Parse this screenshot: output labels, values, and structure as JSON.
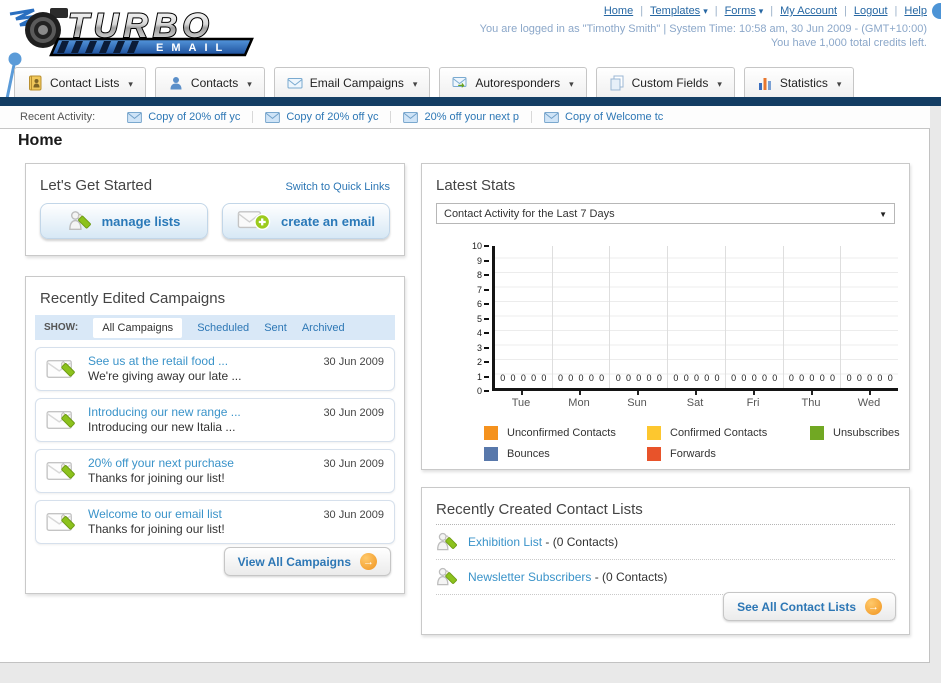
{
  "logo": {
    "brand": "TURBO",
    "sub": "EMAIL"
  },
  "header": {
    "links": [
      {
        "label": "Home",
        "dropdown": false
      },
      {
        "label": "Templates",
        "dropdown": true
      },
      {
        "label": "Forms",
        "dropdown": true
      },
      {
        "label": "My Account",
        "dropdown": false
      },
      {
        "label": "Logout",
        "dropdown": false
      },
      {
        "label": "Help",
        "dropdown": false
      }
    ],
    "login_line1": "You are logged in as \"Timothy Smith\" | System Time: 10:58 am, 30 Jun 2009 - (GMT+10:00)",
    "login_line2": "You have 1,000 total credits left."
  },
  "main_nav": [
    {
      "label": "Contact Lists",
      "icon": "address-book-icon"
    },
    {
      "label": "Contacts",
      "icon": "contact-icon"
    },
    {
      "label": "Email Campaigns",
      "icon": "envelope-icon"
    },
    {
      "label": "Autoresponders",
      "icon": "autoresponder-icon"
    },
    {
      "label": "Custom Fields",
      "icon": "documents-icon"
    },
    {
      "label": "Statistics",
      "icon": "bar-chart-icon"
    }
  ],
  "recent_activity": {
    "label": "Recent Activity:",
    "items": [
      "Copy of 20% off yc",
      "Copy of 20% off yc",
      "20% off your next p",
      "Copy of Welcome tc"
    ]
  },
  "page_title": "Home",
  "get_started": {
    "title": "Let's Get Started",
    "switch_link": "Switch to Quick Links",
    "manage_lists_label": "manage lists",
    "create_email_label": "create an email"
  },
  "campaigns": {
    "title": "Recently Edited Campaigns",
    "show_label": "SHOW:",
    "tabs": [
      "All Campaigns",
      "Scheduled",
      "Sent",
      "Archived"
    ],
    "active_tab": "All Campaigns",
    "items": [
      {
        "title": "See us at the retail food ...",
        "subtitle": "We're giving away our late ...",
        "date": "30 Jun 2009"
      },
      {
        "title": "Introducing our new range ...",
        "subtitle": "Introducing our new Italia ...",
        "date": "30 Jun 2009"
      },
      {
        "title": "20% off your next purchase",
        "subtitle": "Thanks for joining our list!",
        "date": "30 Jun 2009"
      },
      {
        "title": "Welcome to our email list",
        "subtitle": "Thanks for joining our list!",
        "date": "30 Jun 2009"
      }
    ],
    "view_all_label": "View All Campaigns"
  },
  "stats": {
    "title": "Latest Stats",
    "selected_option": "Contact Activity for the Last 7 Days"
  },
  "chart_data": {
    "type": "bar",
    "title": "Contact Activity for the Last 7 Days",
    "categories": [
      "Tue",
      "Mon",
      "Sun",
      "Sat",
      "Fri",
      "Thu",
      "Wed"
    ],
    "series": [
      {
        "name": "Unconfirmed Contacts",
        "color": "#f5921e",
        "values": [
          0,
          0,
          0,
          0,
          0,
          0,
          0
        ]
      },
      {
        "name": "Confirmed Contacts",
        "color": "#fdc72f",
        "values": [
          0,
          0,
          0,
          0,
          0,
          0,
          0
        ]
      },
      {
        "name": "Unsubscribes",
        "color": "#71a823",
        "values": [
          0,
          0,
          0,
          0,
          0,
          0,
          0
        ]
      },
      {
        "name": "Bounces",
        "color": "#5878ab",
        "values": [
          0,
          0,
          0,
          0,
          0,
          0,
          0
        ]
      },
      {
        "name": "Forwards",
        "color": "#e8532a",
        "values": [
          0,
          0,
          0,
          0,
          0,
          0,
          0
        ]
      }
    ],
    "ylim": [
      0,
      10
    ],
    "yticks": [
      0,
      1,
      2,
      3,
      4,
      5,
      6,
      7,
      8,
      9,
      10
    ],
    "grid": true,
    "legend_position": "bottom",
    "value_labels_shown": true
  },
  "contact_lists": {
    "title": "Recently Created Contact Lists",
    "items": [
      {
        "name": "Exhibition List",
        "detail": "- (0 Contacts)"
      },
      {
        "name": "Newsletter Subscribers",
        "detail": "- (0 Contacts)"
      }
    ],
    "see_all_label": "See All Contact Lists"
  },
  "colors": {
    "navy_bar": "#133d63",
    "link_blue": "#2d77b5",
    "login_text_blue": "#8ba7c9",
    "button_orange": "#f0941f",
    "brand_blue": "#2a6fc0"
  }
}
